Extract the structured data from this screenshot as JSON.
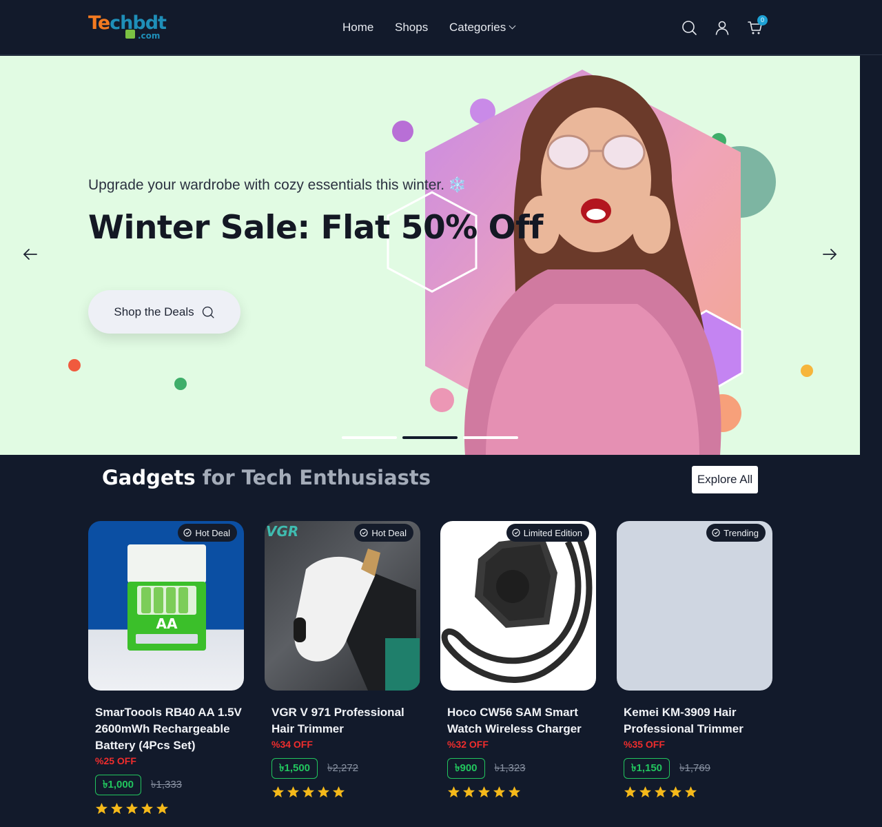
{
  "header": {
    "logo_brand_a": "Te",
    "logo_brand_b": "chbdt",
    "logo_suffix": ".com",
    "nav": {
      "home": "Home",
      "shops": "Shops",
      "categories": "Categories"
    },
    "cart_count": "0"
  },
  "hero": {
    "subtitle": "Upgrade your wardrobe with cozy essentials this winter. ❄️",
    "title": "Winter Sale: Flat 50% Off",
    "cta_label": "Shop the Deals",
    "slides_total": 3,
    "active_slide": 2
  },
  "section": {
    "title_bold": "Gadgets",
    "title_rest": " for Tech Enthusiasts",
    "explore_label": "Explore All"
  },
  "products": [
    {
      "badge": "Hot Deal",
      "name": "SmarToools RB40 AA 1.5V 2600mWh Rechargeable Battery (4Pcs Set)",
      "discount": "%25 OFF",
      "price": "৳1,000",
      "old_price": "৳1,333",
      "rating": 5
    },
    {
      "badge": "Hot Deal",
      "name": "VGR V 971 Professional Hair Trimmer",
      "discount": "%34 OFF",
      "price": "৳1,500",
      "old_price": "৳2,272",
      "rating": 5
    },
    {
      "badge": "Limited Edition",
      "name": "Hoco CW56 SAM Smart Watch Wireless Charger",
      "discount": "%32 OFF",
      "price": "৳900",
      "old_price": "৳1,323",
      "rating": 5
    },
    {
      "badge": "Trending",
      "name": "Kemei KM-3909 Hair Professional Trimmer",
      "discount": "%35 OFF",
      "price": "৳1,150",
      "old_price": "৳1,769",
      "rating": 5
    }
  ],
  "colors": {
    "bg": "#121a2b",
    "hero_bg": "#e1fbe3",
    "accent_green": "#22c55e",
    "discount_red": "#ef2d2d",
    "star": "#f5b91a"
  }
}
